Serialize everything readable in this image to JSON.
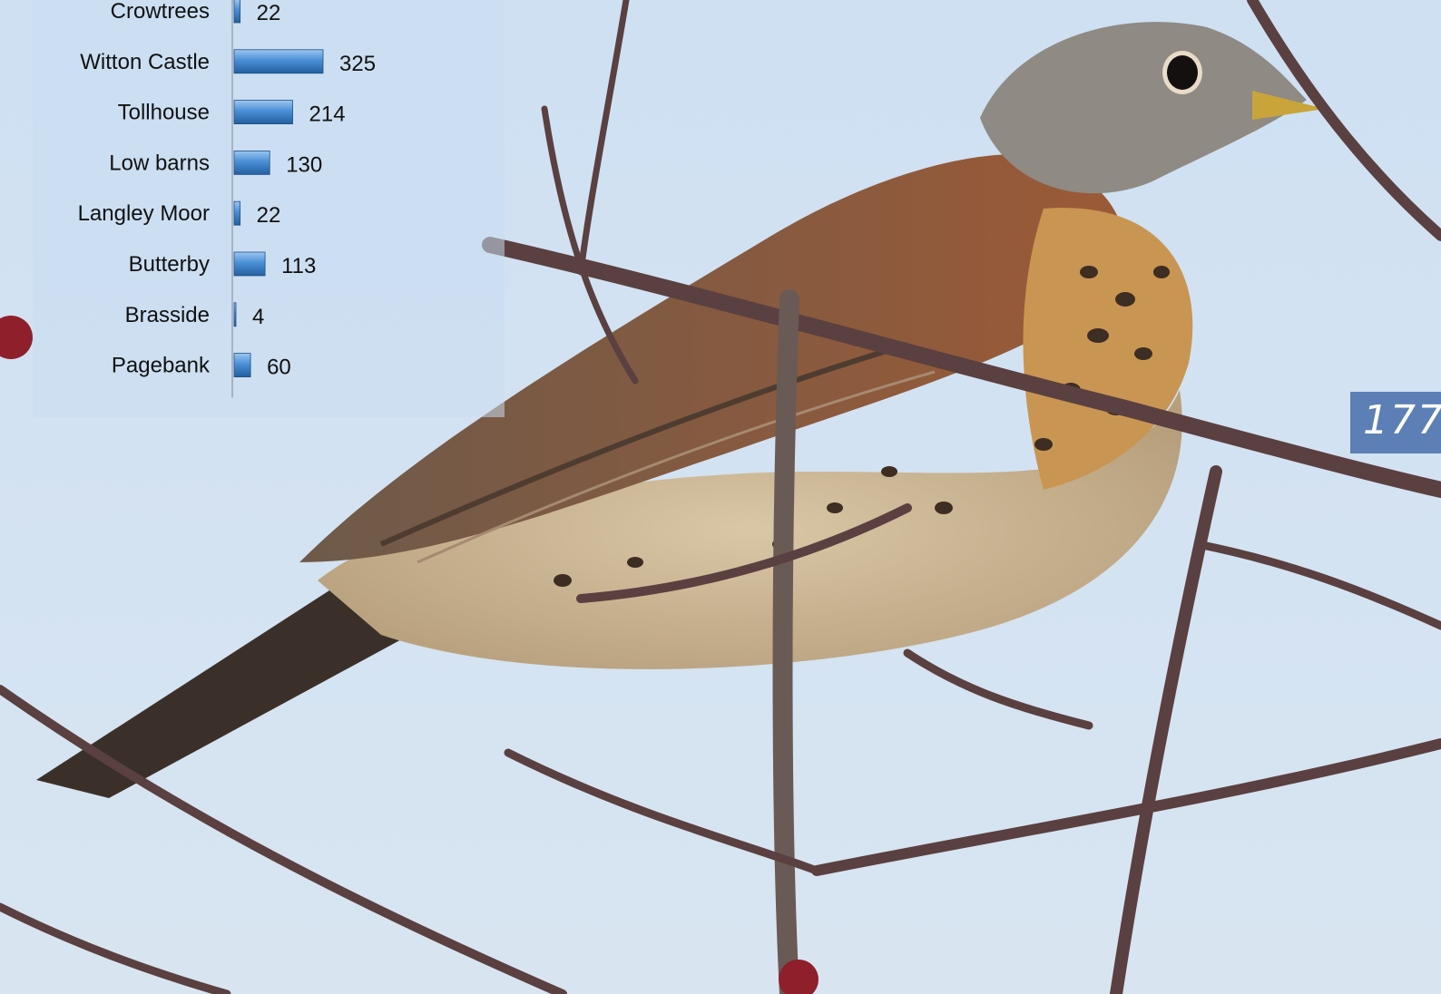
{
  "chart_data": {
    "type": "bar",
    "orientation": "horizontal",
    "categories": [
      "Crowtrees",
      "Witton Castle",
      "Tollhouse",
      "Low barns",
      "Langley Moor",
      "Butterby",
      "Brasside",
      "Pagebank"
    ],
    "values": [
      22,
      325,
      214,
      130,
      22,
      113,
      4,
      60
    ],
    "title": "",
    "xlabel": "",
    "ylabel": "",
    "xlim": [
      0,
      325
    ],
    "grid": false,
    "data_labels": true,
    "bar_color": "#3f7fc4"
  },
  "page": {
    "number": "177"
  },
  "colors": {
    "sky": "#cfe0f1",
    "panel": "#c8dcf0",
    "page_badge": "#466eaa"
  }
}
